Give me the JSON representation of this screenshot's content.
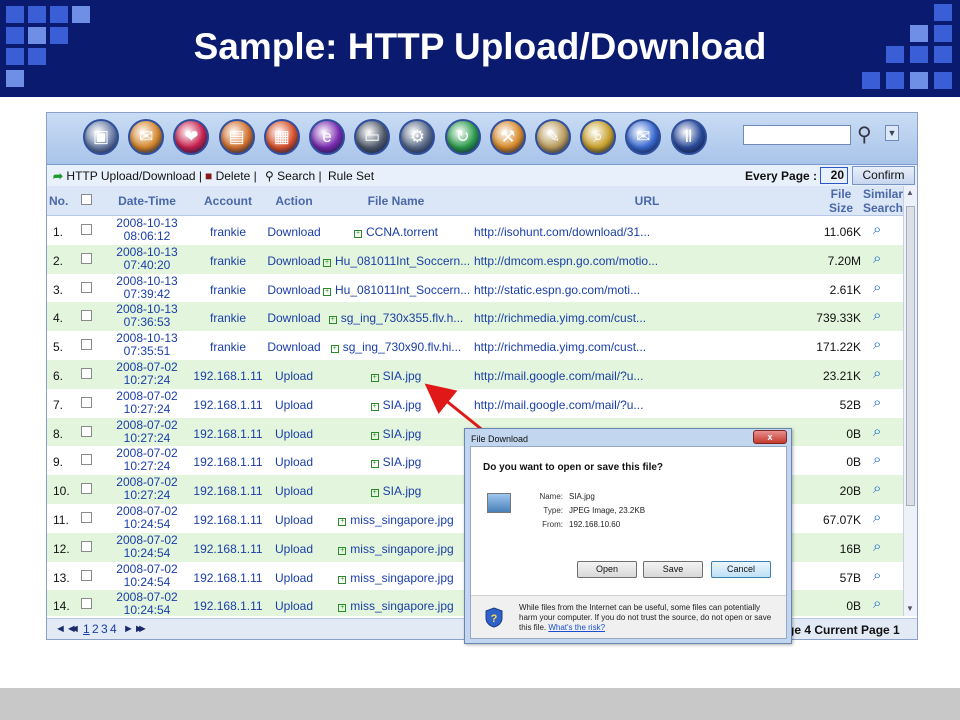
{
  "slide": {
    "title": "Sample: HTTP Upload/Download",
    "colors": {
      "header_bg": "#0a1a6e",
      "accent_square": "#3a5ed6",
      "row_alt": "#e3f5dd",
      "footer_bg": "#c8c8c8"
    }
  },
  "app": {
    "toolbar": {
      "icons": [
        "computer-icon",
        "mail-icon",
        "lips-icon",
        "contacts-icon",
        "firewall-icon",
        "ie-icon",
        "terminal-icon",
        "settings-icon",
        "refresh-icon",
        "tools-icon",
        "notepad-icon",
        "search-doc-icon",
        "mail-send-icon",
        "chart-icon"
      ],
      "search_value": ""
    },
    "menubar": {
      "http_label": "HTTP Upload/Download |",
      "delete_label": "Delete |",
      "search_label": "Search |",
      "ruleset_label": "Rule Set",
      "every_page_label": "Every Page :",
      "every_page_value": "20",
      "confirm_label": "Confirm"
    },
    "table": {
      "headers": {
        "no": "No.",
        "datetime": "Date-Time",
        "account": "Account",
        "action": "Action",
        "filename": "File Name",
        "url": "URL",
        "filesize_1": "File",
        "filesize_2": "Size",
        "similar_1": "Similar",
        "similar_2": "Search"
      },
      "rows": [
        {
          "no": "1.",
          "date": "2008-10-13",
          "time": "08:06:12",
          "account": "frankie",
          "action": "Download",
          "file": "CCNA.torrent",
          "url": "http://isohunt.com/download/31...",
          "size": "11.06K"
        },
        {
          "no": "2.",
          "date": "2008-10-13",
          "time": "07:40:20",
          "account": "frankie",
          "action": "Download",
          "file": "Hu_081011Int_Soccern...",
          "url": "http://dmcom.espn.go.com/motio...",
          "size": "7.20M"
        },
        {
          "no": "3.",
          "date": "2008-10-13",
          "time": "07:39:42",
          "account": "frankie",
          "action": "Download",
          "file": "Hu_081011Int_Soccern...",
          "url": "http://static.espn.go.com/moti...",
          "size": "2.61K"
        },
        {
          "no": "4.",
          "date": "2008-10-13",
          "time": "07:36:53",
          "account": "frankie",
          "action": "Download",
          "file": "sg_ing_730x355.flv.h...",
          "url": "http://richmedia.yimg.com/cust...",
          "size": "739.33K"
        },
        {
          "no": "5.",
          "date": "2008-10-13",
          "time": "07:35:51",
          "account": "frankie",
          "action": "Download",
          "file": "sg_ing_730x90.flv.hi...",
          "url": "http://richmedia.yimg.com/cust...",
          "size": "171.22K"
        },
        {
          "no": "6.",
          "date": "2008-07-02",
          "time": "10:27:24",
          "account": "192.168.1.11",
          "action": "Upload",
          "file": "SIA.jpg",
          "url": "http://mail.google.com/mail/?u...",
          "size": "23.21K"
        },
        {
          "no": "7.",
          "date": "2008-07-02",
          "time": "10:27:24",
          "account": "192.168.1.11",
          "action": "Upload",
          "file": "SIA.jpg",
          "url": "http://mail.google.com/mail/?u...",
          "size": "52B"
        },
        {
          "no": "8.",
          "date": "2008-07-02",
          "time": "10:27:24",
          "account": "192.168.1.11",
          "action": "Upload",
          "file": "SIA.jpg",
          "url": "",
          "size": "0B"
        },
        {
          "no": "9.",
          "date": "2008-07-02",
          "time": "10:27:24",
          "account": "192.168.1.11",
          "action": "Upload",
          "file": "SIA.jpg",
          "url": "",
          "size": "0B"
        },
        {
          "no": "10.",
          "date": "2008-07-02",
          "time": "10:27:24",
          "account": "192.168.1.11",
          "action": "Upload",
          "file": "SIA.jpg",
          "url": "",
          "size": "20B"
        },
        {
          "no": "11.",
          "date": "2008-07-02",
          "time": "10:24:54",
          "account": "192.168.1.11",
          "action": "Upload",
          "file": "miss_singapore.jpg",
          "url": "",
          "size": "67.07K"
        },
        {
          "no": "12.",
          "date": "2008-07-02",
          "time": "10:24:54",
          "account": "192.168.1.11",
          "action": "Upload",
          "file": "miss_singapore.jpg",
          "url": "",
          "size": "16B"
        },
        {
          "no": "13.",
          "date": "2008-07-02",
          "time": "10:24:54",
          "account": "192.168.1.11",
          "action": "Upload",
          "file": "miss_singapore.jpg",
          "url": "",
          "size": "57B"
        },
        {
          "no": "14.",
          "date": "2008-07-02",
          "time": "10:24:54",
          "account": "192.168.1.11",
          "action": "Upload",
          "file": "miss_singapore.jpg",
          "url": "",
          "size": "0B"
        }
      ]
    },
    "pager": {
      "pages": [
        "1",
        "2",
        "3",
        "4"
      ],
      "right_text": "ge 4  Current Page 1"
    }
  },
  "dialog": {
    "title": "File Download",
    "close_label": "x",
    "question": "Do you want to open or save this file?",
    "name_label": "Name:",
    "name_value": "SIA.jpg",
    "type_label": "Type:",
    "type_value": "JPEG Image, 23.2KB",
    "from_label": "From:",
    "from_value": "192.168.10.60",
    "open_label": "Open",
    "save_label": "Save",
    "cancel_label": "Cancel",
    "warning": "While files from the Internet can be useful, some files can potentially harm your computer. If you do not trust the source, do not open or save this file.",
    "risk_link": "What's the risk?"
  }
}
